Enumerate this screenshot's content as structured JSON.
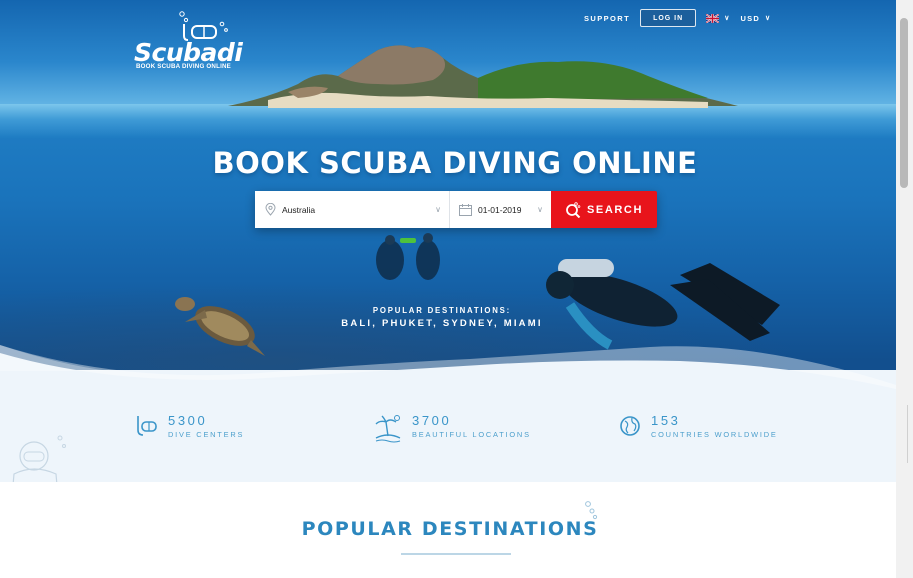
{
  "brand": {
    "name": "Scubadi",
    "tagline": "BOOK SCUBA DIVING ONLINE"
  },
  "nav": {
    "support": "SUPPORT",
    "login": "LOG IN",
    "language_icon": "uk-flag-icon",
    "currency": "USD"
  },
  "hero": {
    "title": "BOOK SCUBA DIVING ONLINE",
    "popular_label": "POPULAR DESTINATIONS:",
    "popular_list": "BALI, PHUKET, SYDNEY, MIAMI"
  },
  "search": {
    "destination_value": "Australia",
    "date_value": "01-01-2019",
    "button_label": "SEARCH"
  },
  "stats": [
    {
      "number": "5300",
      "label": "DIVE CENTERS",
      "icon": "snorkel-mask-icon"
    },
    {
      "number": "3700",
      "label": "BEAUTIFUL LOCATIONS",
      "icon": "palm-island-icon"
    },
    {
      "number": "153",
      "label": "COUNTRIES WORLDWIDE",
      "icon": "globe-icon"
    }
  ],
  "destinations": {
    "title": "POPULAR DESTINATIONS"
  },
  "colors": {
    "accent_red": "#e8141b",
    "stat_blue": "#3a95c9",
    "heading_blue": "#2c87be",
    "ocean_blue": "#1a73bb"
  }
}
